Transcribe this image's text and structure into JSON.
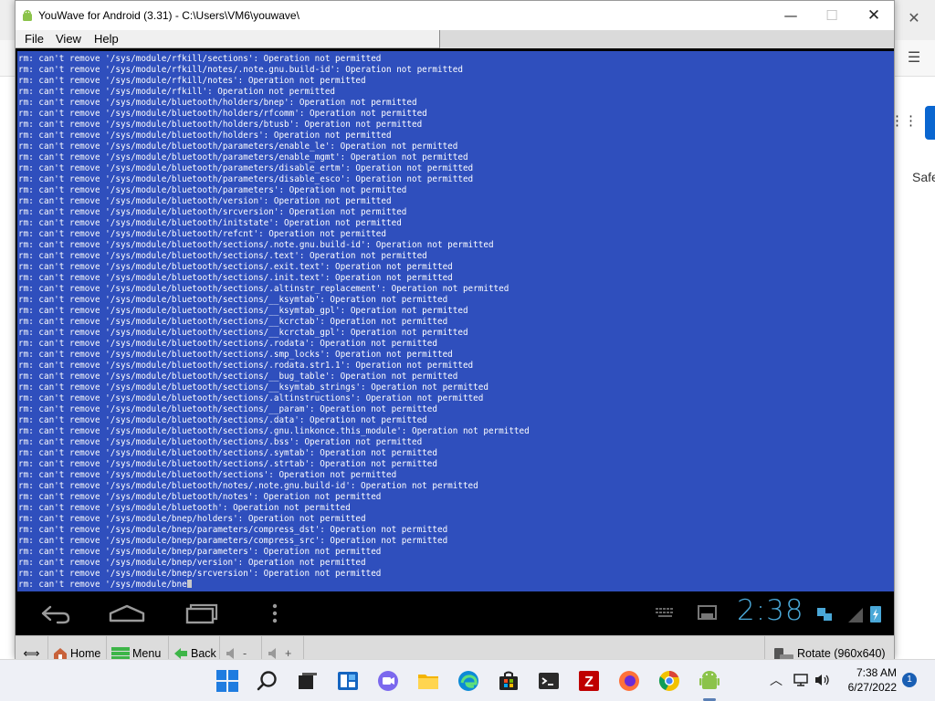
{
  "window": {
    "title": "YouWave for Android (3.31) - C:\\Users\\VM6\\youwave\\",
    "minimize": "—",
    "maximize": "☐",
    "close": "✕"
  },
  "menu": {
    "file": "File",
    "view": "View",
    "help": "Help"
  },
  "terminal": {
    "lines": [
      "rm: can't remove '/sys/module/rfkill/sections': Operation not permitted",
      "rm: can't remove '/sys/module/rfkill/notes/.note.gnu.build-id': Operation not permitted",
      "rm: can't remove '/sys/module/rfkill/notes': Operation not permitted",
      "rm: can't remove '/sys/module/rfkill': Operation not permitted",
      "rm: can't remove '/sys/module/bluetooth/holders/bnep': Operation not permitted",
      "rm: can't remove '/sys/module/bluetooth/holders/rfcomm': Operation not permitted",
      "rm: can't remove '/sys/module/bluetooth/holders/btusb': Operation not permitted",
      "rm: can't remove '/sys/module/bluetooth/holders': Operation not permitted",
      "rm: can't remove '/sys/module/bluetooth/parameters/enable_le': Operation not permitted",
      "rm: can't remove '/sys/module/bluetooth/parameters/enable_mgmt': Operation not permitted",
      "rm: can't remove '/sys/module/bluetooth/parameters/disable_ertm': Operation not permitted",
      "rm: can't remove '/sys/module/bluetooth/parameters/disable_esco': Operation not permitted",
      "rm: can't remove '/sys/module/bluetooth/parameters': Operation not permitted",
      "rm: can't remove '/sys/module/bluetooth/version': Operation not permitted",
      "rm: can't remove '/sys/module/bluetooth/srcversion': Operation not permitted",
      "rm: can't remove '/sys/module/bluetooth/initstate': Operation not permitted",
      "rm: can't remove '/sys/module/bluetooth/refcnt': Operation not permitted",
      "rm: can't remove '/sys/module/bluetooth/sections/.note.gnu.build-id': Operation not permitted",
      "rm: can't remove '/sys/module/bluetooth/sections/.text': Operation not permitted",
      "rm: can't remove '/sys/module/bluetooth/sections/.exit.text': Operation not permitted",
      "rm: can't remove '/sys/module/bluetooth/sections/.init.text': Operation not permitted",
      "rm: can't remove '/sys/module/bluetooth/sections/.altinstr_replacement': Operation not permitted",
      "rm: can't remove '/sys/module/bluetooth/sections/__ksymtab': Operation not permitted",
      "rm: can't remove '/sys/module/bluetooth/sections/__ksymtab_gpl': Operation not permitted",
      "rm: can't remove '/sys/module/bluetooth/sections/__kcrctab': Operation not permitted",
      "rm: can't remove '/sys/module/bluetooth/sections/__kcrctab_gpl': Operation not permitted",
      "rm: can't remove '/sys/module/bluetooth/sections/.rodata': Operation not permitted",
      "rm: can't remove '/sys/module/bluetooth/sections/.smp_locks': Operation not permitted",
      "rm: can't remove '/sys/module/bluetooth/sections/.rodata.str1.1': Operation not permitted",
      "rm: can't remove '/sys/module/bluetooth/sections/__bug_table': Operation not permitted",
      "rm: can't remove '/sys/module/bluetooth/sections/__ksymtab_strings': Operation not permitted",
      "rm: can't remove '/sys/module/bluetooth/sections/.altinstructions': Operation not permitted",
      "rm: can't remove '/sys/module/bluetooth/sections/__param': Operation not permitted",
      "rm: can't remove '/sys/module/bluetooth/sections/.data': Operation not permitted",
      "rm: can't remove '/sys/module/bluetooth/sections/.gnu.linkonce.this_module': Operation not permitted",
      "rm: can't remove '/sys/module/bluetooth/sections/.bss': Operation not permitted",
      "rm: can't remove '/sys/module/bluetooth/sections/.symtab': Operation not permitted",
      "rm: can't remove '/sys/module/bluetooth/sections/.strtab': Operation not permitted",
      "rm: can't remove '/sys/module/bluetooth/sections': Operation not permitted",
      "rm: can't remove '/sys/module/bluetooth/notes/.note.gnu.build-id': Operation not permitted",
      "rm: can't remove '/sys/module/bluetooth/notes': Operation not permitted",
      "rm: can't remove '/sys/module/bluetooth': Operation not permitted",
      "rm: can't remove '/sys/module/bnep/holders': Operation not permitted",
      "rm: can't remove '/sys/module/bnep/parameters/compress_dst': Operation not permitted",
      "rm: can't remove '/sys/module/bnep/parameters/compress_src': Operation not permitted",
      "rm: can't remove '/sys/module/bnep/parameters': Operation not permitted",
      "rm: can't remove '/sys/module/bnep/version': Operation not permitted",
      "rm: can't remove '/sys/module/bnep/srcversion': Operation not permitted",
      "rm: can't remove '/sys/module/bne"
    ]
  },
  "android": {
    "clock": "2:38",
    "icons": [
      "back-icon",
      "home-icon",
      "recents-icon",
      "overflow-icon",
      "keyboard-icon",
      "screen-icon",
      "signal-icon",
      "battery-icon"
    ]
  },
  "toolbar": {
    "home": "Home",
    "menu": "Menu",
    "back": "Back",
    "vol_down": "-",
    "vol_up": "+",
    "rotate": "Rotate (960x640)"
  },
  "background": {
    "tab_text": "Safe"
  },
  "taskbar": {
    "time": "7:38 AM",
    "date": "6/27/2022",
    "notifications": "1",
    "apps": [
      "start",
      "search",
      "task-view",
      "widgets",
      "teams-chat",
      "file-explorer",
      "edge",
      "store",
      "terminal",
      "filezilla",
      "firefox",
      "chrome",
      "youwave"
    ]
  },
  "colors": {
    "terminal_bg": "#2f4fbd",
    "clock": "#4aa8d8",
    "android_bg": "#000000"
  }
}
